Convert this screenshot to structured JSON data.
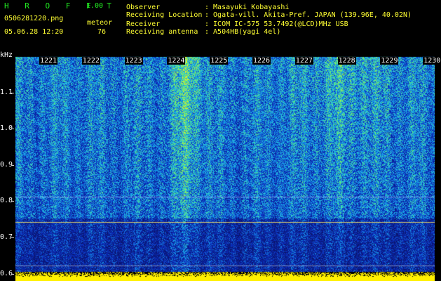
{
  "header": {
    "app_name": "H R O F F T",
    "version": "1.00",
    "filename": "0506281220.png",
    "meteor_label": "meteor",
    "datetime": "05.06.28 12:20",
    "meteor_count": "76"
  },
  "info": {
    "rows": [
      {
        "label": "Observer",
        "value": ":  Masayuki Kobayashi"
      },
      {
        "label": "Receiving Location",
        "value": ":  Ogata-vill. Akita-Pref. JAPAN (139.96E, 40.02N)"
      },
      {
        "label": "Receiver",
        "value": ":  ICOM IC-575 53.7492(@LCD)MHz USB"
      },
      {
        "label": "Receiving antenna",
        "value": ":  A504HB(yagi 4el)"
      }
    ]
  },
  "spectrogram": {
    "y_unit": "kHz",
    "y_ticks": [
      "1.1",
      "1.0",
      "0.9",
      "0.8",
      "0.7",
      "0.6"
    ],
    "y_values": [
      1.1,
      1.0,
      0.9,
      0.8,
      0.7,
      0.6
    ],
    "y_range": [
      0.58,
      1.2
    ],
    "time_ticks": [
      "1221",
      "1222",
      "1223",
      "1224",
      "1225",
      "1226",
      "1227",
      "1228",
      "1229",
      "1230"
    ],
    "colors": {
      "background": "#000000",
      "noise_low": "#0a1f8a",
      "noise_high": "#2fd6ff",
      "signal": "#8cff5a",
      "bottom_bar": "#ffff00"
    }
  }
}
